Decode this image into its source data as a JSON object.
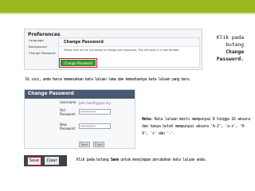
{
  "preferences": {
    "title": "Preferences",
    "sidebar": [
      "Language",
      "Background",
      "Change Password"
    ],
    "panel_header": "Change Password",
    "info": "Please click on the link below to change your password. This will open in a new window.",
    "button": "Change Password"
  },
  "annotations": {
    "top_prefix": "Klik pada butang",
    "top_bold": "Change Password.",
    "middle": "Di sini, anda harus memasukkan kata laluan lama dan kemudiannya kata laluan yang baru.",
    "note_label": "Nota:",
    "note_text": "Kata laluan mesti mempunyai 8 hingga 16 aksara dan hanya boleh mempunyai aksara 'A-Z', 'a-z', '0-9', '+' dan '-'.",
    "bottom_prefix": "Klik pada butang",
    "bottom_bold": "Save",
    "bottom_suffix": "untuk menyimpan perubahan kata laluan anda."
  },
  "change_password": {
    "header": "Change Password",
    "username_label": "Username:",
    "username_value": "John.Smith@yes.my",
    "old_label": "Old Password:",
    "old_value": "••••••••",
    "new_label": "New Password:",
    "new_value": "••••••••",
    "save_label": "Save",
    "clear_label": "Clear"
  },
  "bottom_bar": {
    "save_label": "Save",
    "clear_label": "Clear"
  }
}
